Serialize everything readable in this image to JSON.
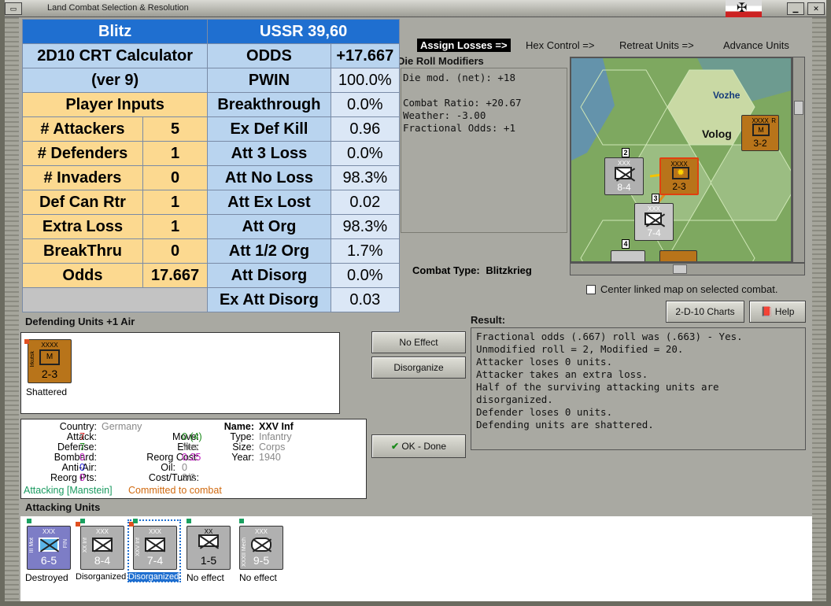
{
  "window": {
    "title": "Land Combat Selection & Resolution"
  },
  "calculator": {
    "header_left": "Blitz",
    "header_right": "USSR 39,60",
    "title_line1": "2D10 CRT Calculator",
    "title_line2": "(ver 9)",
    "inputs_title": "Player Inputs",
    "inputs": [
      {
        "label": "# Attackers",
        "value": "5"
      },
      {
        "label": "# Defenders",
        "value": "1"
      },
      {
        "label": "# Invaders",
        "value": "0"
      },
      {
        "label": "Def Can Rtr",
        "value": "1"
      },
      {
        "label": "Extra Loss",
        "value": "1"
      },
      {
        "label": "BreakThru",
        "value": "0"
      },
      {
        "label": "Odds",
        "value": "17.667"
      }
    ],
    "results": [
      {
        "label": "ODDS",
        "value": "+17.667"
      },
      {
        "label": "PWIN",
        "value": "100.0%"
      },
      {
        "label": "Breakthrough",
        "value": "0.0%"
      },
      {
        "label": "Ex Def Kill",
        "value": "0.96"
      },
      {
        "label": "Att 3 Loss",
        "value": "0.0%"
      },
      {
        "label": "Att No Loss",
        "value": "98.3%"
      },
      {
        "label": "Att Ex Lost",
        "value": "0.02"
      },
      {
        "label": "Att Org",
        "value": "98.3%"
      },
      {
        "label": "Att 1/2 Org",
        "value": "1.7%"
      },
      {
        "label": "Att Disorg",
        "value": "0.0%"
      },
      {
        "label": "Ex Att Disorg",
        "value": "0.03"
      }
    ]
  },
  "toolbar": {
    "assign_losses": "Assign Losses =>",
    "hex_control": "Hex Control =>",
    "retreat_units": "Retreat Units =>",
    "advance_units": "Advance Units"
  },
  "die_roll": {
    "title": "Die Roll Modifiers",
    "lines": [
      "Die mod. (net): +18",
      "",
      "Combat Ratio: +20.67",
      "Weather: -3.00",
      "Fractional Odds: +1"
    ]
  },
  "combat_type": {
    "label": "Combat Type:",
    "value": "Blitzkrieg"
  },
  "map": {
    "labels": [
      "Vozhe",
      "Volog"
    ],
    "units": [
      {
        "size": "XXX",
        "side": "XX Inf",
        "strength": "8-4",
        "stack": "2"
      },
      {
        "size": "XXXX",
        "side": "Irkutsk",
        "strength": "2-3"
      },
      {
        "size": "XXX",
        "side": "",
        "strength": "7-4",
        "stack": "3"
      },
      {
        "size": "XXXX",
        "side": "Murmansk",
        "strength": "3-2",
        "corner": "R"
      },
      {
        "size": "",
        "side": "",
        "strength": "",
        "stack": "4"
      }
    ]
  },
  "center_map": {
    "label": "Center linked map on selected combat.",
    "checked": false
  },
  "buttons": {
    "charts": "2-D-10 Charts",
    "help": "Help",
    "no_effect": "No Effect",
    "disorganize": "Disorganize",
    "ok_done": "OK - Done"
  },
  "defending": {
    "title": "Defending Units +1 Air",
    "units": [
      {
        "size": "XXXX",
        "side": "Irkutsk",
        "strength": "2-3",
        "status": "Shattered"
      }
    ]
  },
  "result": {
    "title": "Result:",
    "lines": [
      "Fractional odds (.667) roll was (.663)  - Yes.",
      "Unmodified roll = 2, Modified = 20.",
      "Attacker loses 0 units.",
      "Attacker takes an extra loss.",
      "Half of the surviving attacking units are disorganized.",
      "Defender loses 0 units.",
      "Defending units are shattered."
    ]
  },
  "unit_info": {
    "country_label": "Country:",
    "country": "Germany",
    "attack_label": "Attack:",
    "attack": "7",
    "defense_label": "Defense:",
    "defense": "7",
    "bombard_label": "Bombard:",
    "bombard": "0",
    "antiair_label": "Anti-Air:",
    "antiair": "0",
    "reorg_label": "Reorg Pts:",
    "reorg": "0",
    "name_label": "Name:",
    "name": "XXV Inf",
    "move_label": "Move:",
    "move": "0 (4)",
    "type_label": "Type:",
    "type": "Infantry",
    "elite_label": "Elite:",
    "elite": "Yes",
    "size_label": "Size:",
    "size": "Corps",
    "reorgcost_label": "Reorg Cost:",
    "reorgcost": "0.25",
    "year_label": "Year:",
    "year": "1940",
    "oil_label": "Oil:",
    "oil": "0",
    "costturns_label": "Cost/Turns:",
    "costturns": "3/2",
    "attacking_text": "Attacking [Manstein]",
    "committed_text": "Committed to combat"
  },
  "attacking": {
    "title": "Attacking Units",
    "units": [
      {
        "size": "XXX",
        "side": "III Mot",
        "tag": "FIN",
        "strength": "6-5",
        "status": "Destroyed",
        "color": "#7d7dc6"
      },
      {
        "size": "XXX",
        "side": "XX Inf",
        "tag": "",
        "strength": "8-4",
        "status": "Disorganized",
        "color": "#b0b0b0"
      },
      {
        "size": "XXX",
        "side": "XXV Inf",
        "tag": "",
        "strength": "7-4",
        "status": "Disorganized",
        "color": "#b0b0b0"
      },
      {
        "size": "XX",
        "side": "",
        "tag": "",
        "strength": "1-5",
        "status": "No effect",
        "color": "#b0b0b0"
      },
      {
        "size": "XXX",
        "side": "XXXII Mech",
        "tag": "",
        "strength": "9-5",
        "status": "No effect",
        "color": "#b0b0b0"
      }
    ]
  },
  "colors": {
    "german_grey": "#b0b0b0",
    "soviet_brown": "#b8741a",
    "finn_blue": "#7d7dc6",
    "calc_blue": "#1f6fd0"
  }
}
